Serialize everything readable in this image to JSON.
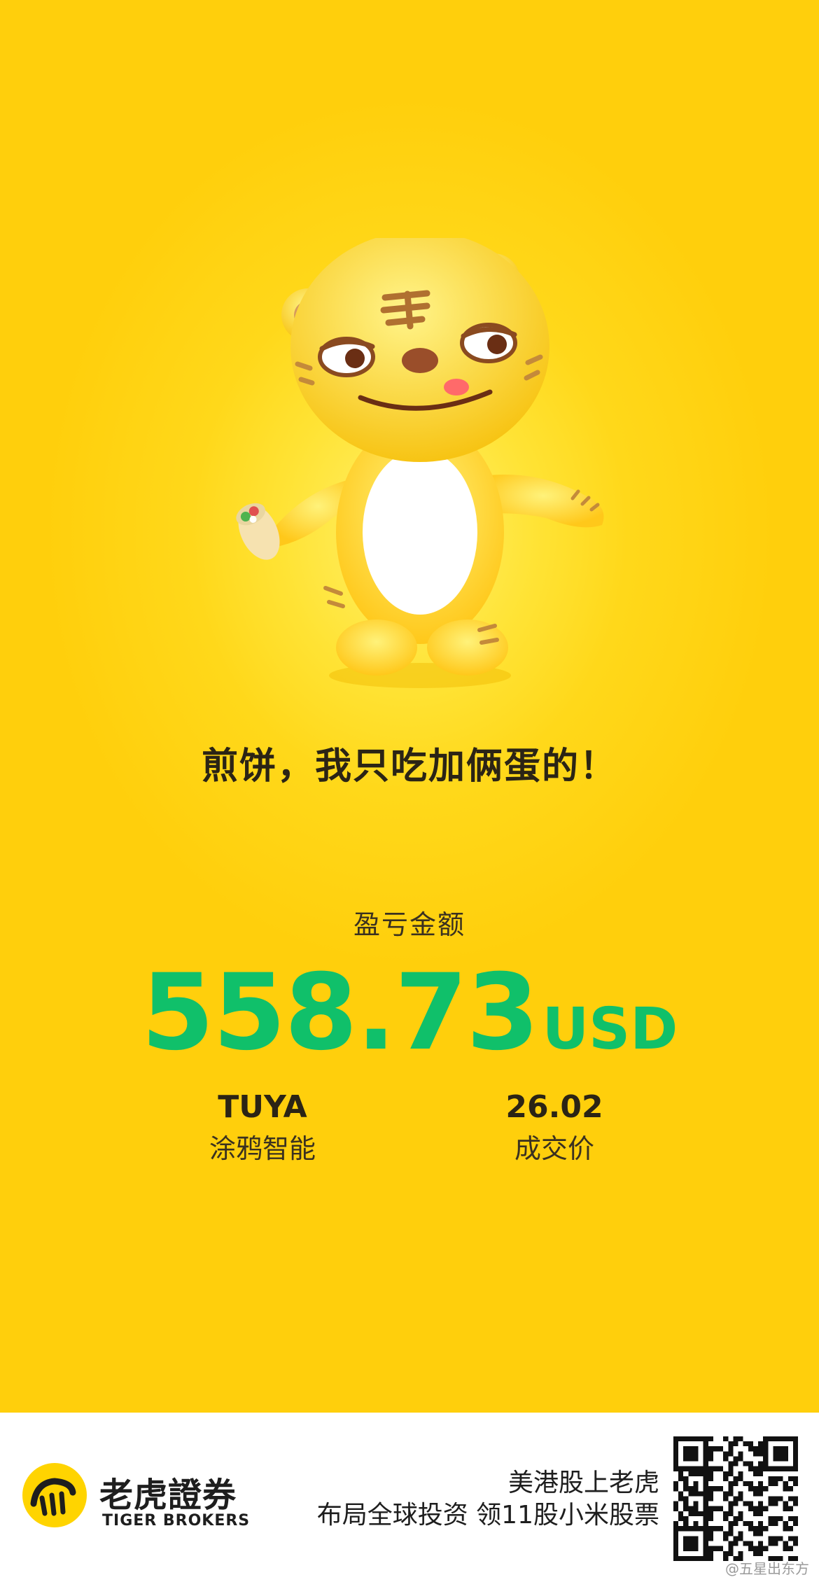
{
  "slogan": "煎饼，我只吃加俩蛋的！",
  "profit": {
    "label": "盈亏金额",
    "amount": "558.73",
    "currency": "USD",
    "color": "#10c06a"
  },
  "stock": {
    "ticker": "TUYA",
    "name": "涂鸦智能"
  },
  "trade": {
    "price": "26.02",
    "price_label": "成交价"
  },
  "footer": {
    "brand_cn": "老虎證券",
    "brand_en": "TIGER BROKERS",
    "promo_line1": "美港股上老虎",
    "promo_line2": "布局全球投资 领11股小米股票",
    "watermark": "@五星出东方"
  },
  "colors": {
    "background": "#ffd81a",
    "footer": "#ffffff",
    "brand_yellow": "#ffd400"
  },
  "icons": [
    "tiger-mascot-illustration",
    "tiger-logo-icon",
    "qr-code-icon"
  ]
}
